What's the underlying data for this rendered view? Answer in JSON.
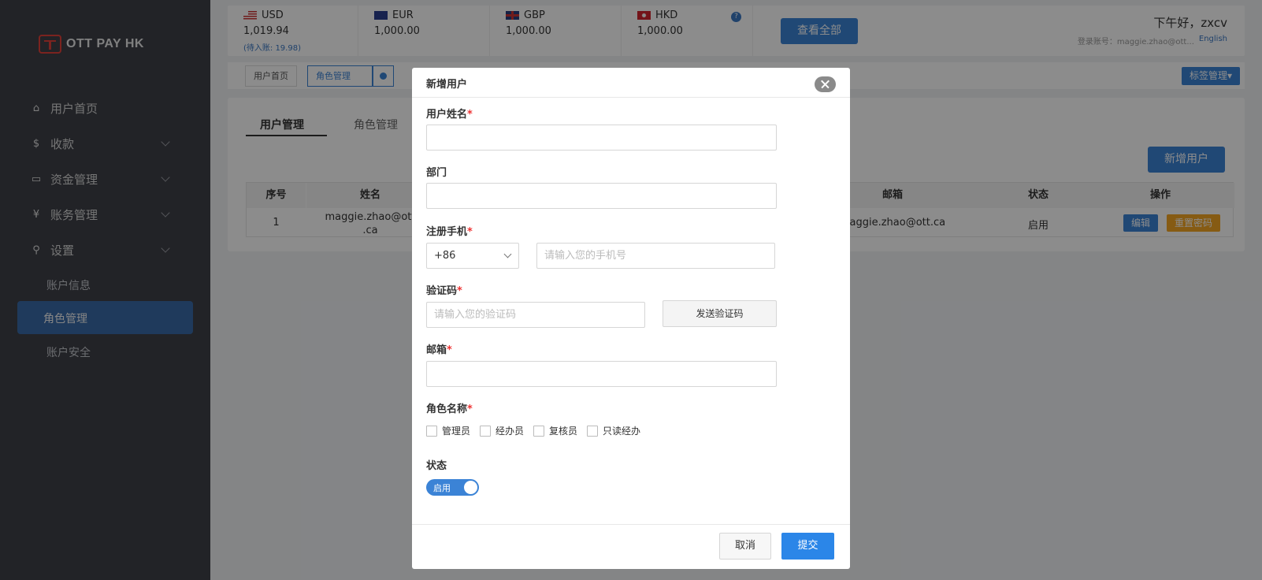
{
  "app": {
    "logo_text": "OTT PAY HK",
    "brand_color": "#e0403a",
    "accent_color": "#3b83d6"
  },
  "sidebar": {
    "items": [
      {
        "label": "用户首页",
        "icon": "home-icon"
      },
      {
        "label": "收款",
        "icon": "dollar-icon"
      },
      {
        "label": "资金管理",
        "icon": "card-icon"
      },
      {
        "label": "账务管理",
        "icon": "yen-icon"
      },
      {
        "label": "设置",
        "icon": "search-icon"
      }
    ],
    "sub_items": [
      {
        "label": "账户信息"
      },
      {
        "label": "角色管理"
      },
      {
        "label": "账户安全"
      }
    ]
  },
  "balances": [
    {
      "code": "USD",
      "amount": "1,019.94",
      "pending": "(待入账: 19.98)"
    },
    {
      "code": "EUR",
      "amount": "1,000.00"
    },
    {
      "code": "GBP",
      "amount": "1,000.00"
    },
    {
      "code": "HKD",
      "amount": "1,000.00"
    }
  ],
  "header": {
    "help": "?",
    "view_all": "查看全部",
    "greeting": "下午好，zxcv",
    "account_label": "登录账号：maggie.zhao@ott...",
    "language": "English"
  },
  "tabbar": {
    "tab1": "用户首页",
    "tab2": "角色管理",
    "tag_mgmt": "标签管理▾"
  },
  "panel": {
    "tabs": [
      "用户管理",
      "角色管理"
    ],
    "add_user": "新增用户",
    "columns": {
      "index": "序号",
      "name": "姓名",
      "email": "邮箱",
      "status": "状态",
      "action": "操作"
    },
    "row": {
      "index": "1",
      "name": "maggie.zhao@ott",
      "name2": ".ca",
      "email": "maggie.zhao@ott.ca",
      "status": "启用",
      "edit": "编辑",
      "reset": "重置密码"
    }
  },
  "modal": {
    "title": "新增用户",
    "fields": {
      "username": {
        "label": "用户姓名",
        "value": ""
      },
      "department": {
        "label": "部门",
        "value": ""
      },
      "phone": {
        "label": "注册手机",
        "country_code": "+86",
        "placeholder": "请输入您的手机号"
      },
      "code": {
        "label": "验证码",
        "placeholder": "请输入您的验证码",
        "send": "发送验证码"
      },
      "email": {
        "label": "邮箱",
        "value": ""
      },
      "roles": {
        "label": "角色名称",
        "options": [
          "管理员",
          "经办员",
          "复核员",
          "只读经办"
        ]
      },
      "status": {
        "label": "状态",
        "toggle_label": "启用",
        "enabled": true
      }
    },
    "required_mark": "*",
    "cancel": "取消",
    "submit": "提交"
  }
}
